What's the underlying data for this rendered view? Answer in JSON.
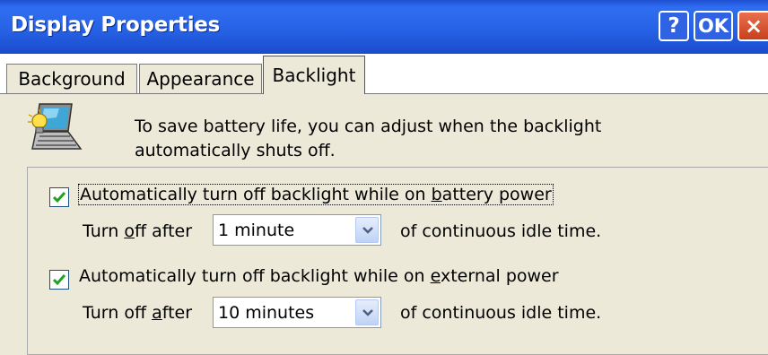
{
  "window": {
    "title": "Display Properties",
    "help_label": "?",
    "ok_label": "OK",
    "close_label": "×"
  },
  "tabs": [
    {
      "label": "Background"
    },
    {
      "label": "Appearance"
    },
    {
      "label": "Backlight",
      "selected": true
    }
  ],
  "info": {
    "icon": "laptop-backlight-icon",
    "text_line1": "To save battery life, you can adjust when the backlight",
    "text_line2": "automatically shuts off."
  },
  "battery": {
    "checked": true,
    "label_pre": "Automatically turn off backlight while on ",
    "label_hot": "b",
    "label_post": "attery power",
    "turn_off_pre": "Turn ",
    "turn_off_hot": "o",
    "turn_off_post": "ff after",
    "value": "1 minute",
    "suffix": "of continuous idle time."
  },
  "external": {
    "checked": true,
    "label_pre": "Automatically turn off backlight while on ",
    "label_hot": "e",
    "label_post": "xternal power",
    "turn_off_pre": "Turn off ",
    "turn_off_hot": "a",
    "turn_off_post": "fter",
    "value": "10 minutes",
    "suffix": "of continuous idle time."
  },
  "colors": {
    "titlebar": "#2762e6",
    "dialog_bg": "#ece9d8",
    "checkmark": "#21a121",
    "close_button": "#d9542f"
  }
}
